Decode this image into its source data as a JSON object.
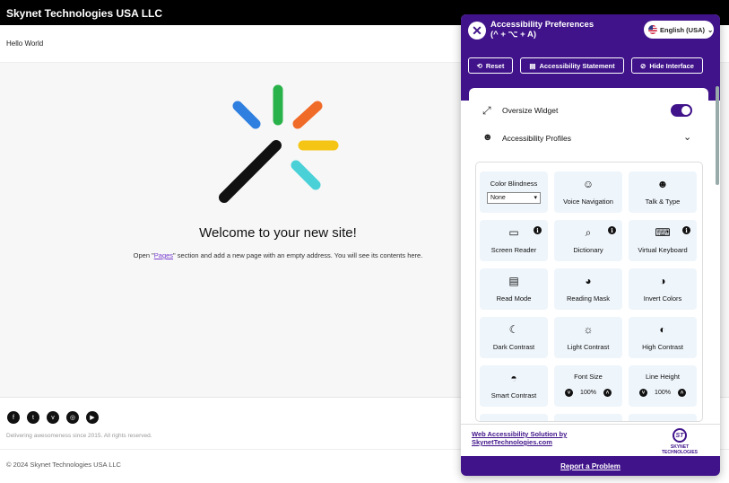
{
  "site": {
    "top_title": "Skynet Technologies USA LLC",
    "subheader": "Hello World",
    "welcome": "Welcome to your new site!",
    "open_prefix": "Open \"",
    "open_link": "Pages",
    "open_suffix": "\" section and add a new page with an empty address. You will see its contents here.",
    "tagline": "Delivering awesomeness since 2015. All rights reserved.",
    "copyright": "© 2024 Skynet Technologies USA LLC",
    "social_icons": [
      "facebook-icon",
      "twitter-icon",
      "vk-icon",
      "instagram-icon",
      "youtube-icon"
    ]
  },
  "panel": {
    "title_line1": "Accessibility Preferences",
    "title_line2": "(^ + ⌥ + A)",
    "language": "English (USA)",
    "reset": "Reset",
    "statement": "Accessibility Statement",
    "hide": "Hide Interface",
    "oversize_label": "Oversize Widget",
    "profiles_label": "Accessibility Profiles",
    "tiles": {
      "color_blindness": "Color Blindness",
      "color_blindness_value": "None",
      "voice_navigation": "Voice Navigation",
      "talk_type": "Talk & Type",
      "screen_reader": "Screen Reader",
      "dictionary": "Dictionary",
      "virtual_keyboard": "Virtual Keyboard",
      "read_mode": "Read Mode",
      "reading_mask": "Reading Mask",
      "invert_colors": "Invert Colors",
      "dark_contrast": "Dark Contrast",
      "light_contrast": "Light Contrast",
      "high_contrast": "High Contrast",
      "smart_contrast": "Smart Contrast",
      "font_size": "Font Size",
      "font_size_value": "100%",
      "line_height": "Line Height",
      "line_height_value": "100%"
    },
    "footer_link": "Web Accessibility Solution by SkynetTechnologies.com",
    "brand_mark": "ST",
    "brand_name": "SKYNET TECHNOLOGIES",
    "report": "Report a Problem"
  },
  "colors": {
    "accent": "#40138a",
    "tile_bg": "#eef5fb"
  }
}
